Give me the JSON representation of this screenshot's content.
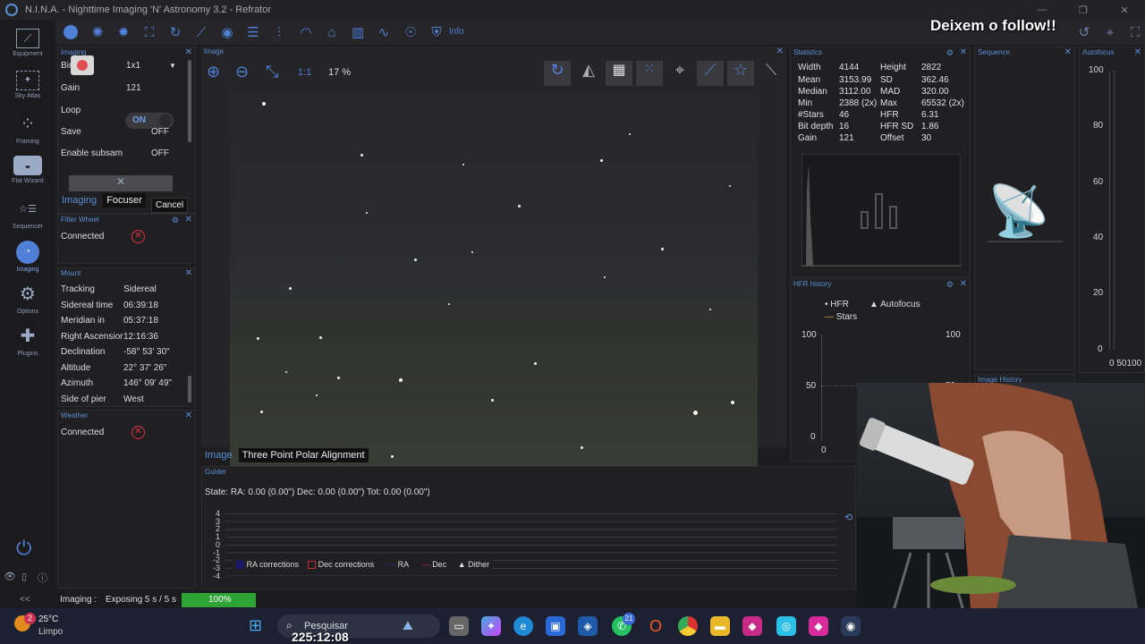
{
  "window": {
    "title": "N.I.N.A. - Nighttime Imaging 'N' Astronomy 3.2 - Refrator",
    "buttons": [
      "—",
      "❐",
      "✕"
    ]
  },
  "overlay_text": "Deixem o follow!!",
  "toolbar": {
    "info_label": "Info"
  },
  "nav": [
    {
      "label": "Equipment",
      "icon": "telescope-icon"
    },
    {
      "label": "Sky Atlas",
      "icon": "map-icon"
    },
    {
      "label": "Framing",
      "icon": "framing-icon"
    },
    {
      "label": "Flat Wizard",
      "icon": "flat-icon"
    },
    {
      "label": "Sequencer",
      "icon": "sequencer-icon"
    },
    {
      "label": "Imaging",
      "icon": "imaging-icon"
    },
    {
      "label": "Options",
      "icon": "gear-icon"
    },
    {
      "label": "Plugins",
      "icon": "puzzle-icon"
    }
  ],
  "imaging_panel": {
    "header": "Imaging",
    "binning_label": "Binning",
    "binning_value": "1x1",
    "gain_label": "Gain",
    "gain_value": "121",
    "loop_label": "Loop",
    "loop_value": "ON",
    "save_label": "Save",
    "save_value": "OFF",
    "subsam_label": "Enable subsam",
    "subsam_value": "OFF",
    "tabs": [
      "Imaging",
      "Focuser"
    ],
    "tooltip": "Cancel"
  },
  "filter_wheel": {
    "header": "Filter Wheel",
    "status": "Connected"
  },
  "mount": {
    "header": "Mount",
    "rows": [
      [
        "Tracking",
        "Sidereal"
      ],
      [
        "Sidereal time",
        "06:39:18"
      ],
      [
        "Meridian in",
        "05:37:18"
      ],
      [
        "Right Ascension",
        "12:16:36"
      ],
      [
        "Declination",
        "-58° 53' 30\""
      ],
      [
        "Altitude",
        "22° 37' 26\""
      ],
      [
        "Azimuth",
        "146° 09' 49\""
      ],
      [
        "Side of pier",
        "West"
      ]
    ]
  },
  "weather": {
    "header": "Weather",
    "status": "Connected"
  },
  "image_panel": {
    "header": "Image",
    "zoom_1to1": "1:1",
    "zoom_pct": "17 %",
    "tabs": [
      "Image",
      "Three Point Polar Alignment"
    ]
  },
  "statistics": {
    "header": "Statistics",
    "rows": [
      [
        "Width",
        "4144",
        "Height",
        "2822"
      ],
      [
        "Mean",
        "3153.99",
        "SD",
        "362.46"
      ],
      [
        "Median",
        "3112.00",
        "MAD",
        "320.00"
      ],
      [
        "Min",
        "2388 (2x)",
        "Max",
        "65532 (2x)"
      ],
      [
        "#Stars",
        "46",
        "HFR",
        "6.31"
      ],
      [
        "Bit depth",
        "16",
        "HFR SD",
        "1.86"
      ],
      [
        "Gain",
        "121",
        "Offset",
        "30"
      ]
    ]
  },
  "hfr_history": {
    "header": "HFR history",
    "legend": [
      "HFR",
      "Autofocus",
      "Stars"
    ],
    "yticks_left": [
      "100",
      "50",
      "0"
    ],
    "yticks_right": [
      "100",
      "50"
    ],
    "xtick": "0"
  },
  "sequence": {
    "header": "Sequence",
    "footer": "Image History"
  },
  "autofocus": {
    "header": "Autofocus",
    "yticks": [
      "100",
      "80",
      "60",
      "40",
      "20",
      "0"
    ],
    "xticks": "0 50100"
  },
  "guider": {
    "header": "Guider",
    "state": "State:  RA: 0.00 (0.00\")  Dec: 0.00 (0.00\")  Tot: 0.00 (0.00\")",
    "yticks": [
      "4",
      "3",
      "2",
      "1",
      "0",
      "-1",
      "-2",
      "-3",
      "-4"
    ],
    "legend": [
      "RA corrections",
      "Dec corrections",
      "RA",
      "Dec",
      "Dither"
    ]
  },
  "status": {
    "collapse": "<<",
    "label": "Imaging :",
    "detail": "Exposing 5 s / 5 s",
    "progress_text": "100%",
    "progress": 1.0
  },
  "taskbar": {
    "temp": "25°C",
    "weather": "Limpo",
    "search": "Pesquisar",
    "badge_wx": "2",
    "badge_wa": "21",
    "clock": "225:12:08"
  }
}
